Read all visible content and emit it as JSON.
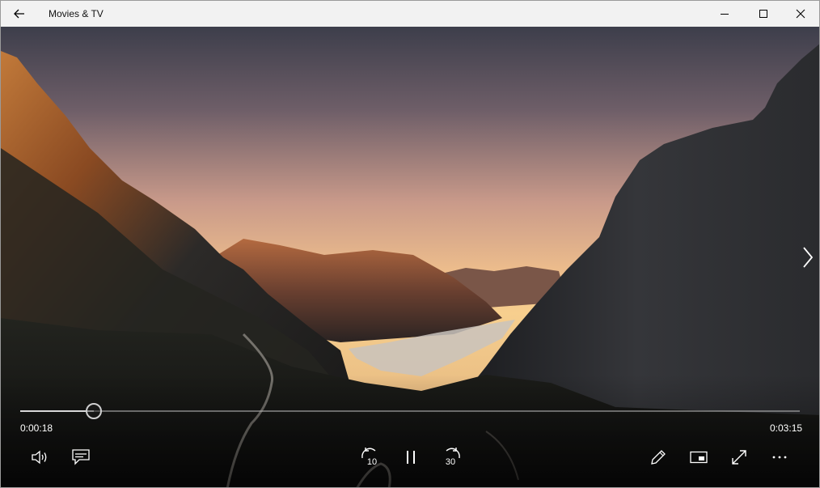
{
  "window": {
    "title": "Movies & TV",
    "icons": {
      "back": "back-arrow-icon",
      "minimize": "minimize-icon",
      "maximize": "maximize-icon",
      "close": "close-icon"
    }
  },
  "player": {
    "current_time": "0:00:18",
    "total_time": "0:03:15",
    "progress_fraction": 0.094,
    "skip_back_seconds": "10",
    "skip_forward_seconds": "30",
    "controls": {
      "left": [
        "volume-icon",
        "subtitles-icon"
      ],
      "center": [
        "skip-back-10-icon",
        "pause-icon",
        "skip-forward-30-icon"
      ],
      "right": [
        "edit-pencil-icon",
        "mini-view-icon",
        "fullscreen-icon",
        "more-options-icon"
      ]
    },
    "next_icon": "chevron-right-icon"
  },
  "colors": {
    "titlebar_bg": "#f2f2f2",
    "sky_top": "#3c3d4a",
    "sky_horizon": "#f5c78e",
    "control_fg": "#ffffff"
  }
}
